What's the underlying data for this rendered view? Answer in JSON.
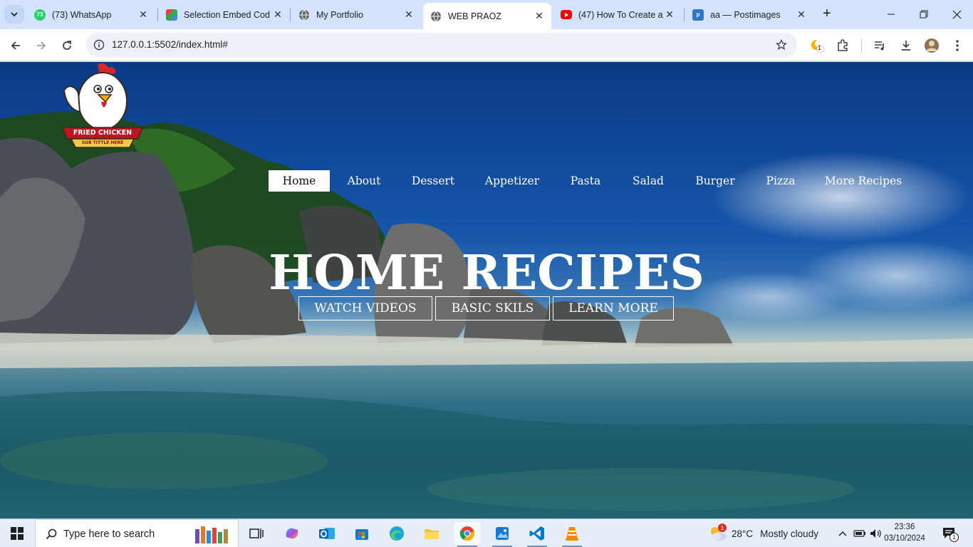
{
  "browser": {
    "tabs": [
      {
        "title": "(73) WhatsApp",
        "favicon": "whatsapp-icon",
        "badge": "73",
        "active": false
      },
      {
        "title": "Selection Embed Cod",
        "favicon": "google-sheets-icon",
        "active": false
      },
      {
        "title": "My Portfolio",
        "favicon": "globe-icon",
        "active": false
      },
      {
        "title": "WEB PRAOZ",
        "favicon": "globe-icon",
        "active": true
      },
      {
        "title": "(47) How To Create a",
        "favicon": "youtube-icon",
        "active": false
      },
      {
        "title": "aa — Postimages",
        "favicon": "postimages-icon",
        "active": false
      }
    ],
    "url": "127.0.0.1:5502/index.html#",
    "extension_badge": "1"
  },
  "page": {
    "logo_title": "FRIED CHICKEN",
    "logo_subtitle": "SUB TITTLE HERE",
    "nav": [
      {
        "label": "Home",
        "active": true
      },
      {
        "label": "About",
        "active": false
      },
      {
        "label": "Dessert",
        "active": false
      },
      {
        "label": "Appetizer",
        "active": false
      },
      {
        "label": "Pasta",
        "active": false
      },
      {
        "label": "Salad",
        "active": false
      },
      {
        "label": "Burger",
        "active": false
      },
      {
        "label": "Pizza",
        "active": false
      },
      {
        "label": "More Recipes",
        "active": false
      }
    ],
    "hero_title": "HOME RECIPES",
    "buttons": [
      "WATCH VIDEOS",
      "BASIC SKILS",
      "LEARN MORE"
    ]
  },
  "taskbar": {
    "search_placeholder": "Type here to search",
    "weather_temp": "28°C",
    "weather_desc": "Mostly cloudy",
    "weather_badge": "1",
    "time": "23:36",
    "date": "03/10/2024",
    "notification_count": "1"
  },
  "colors": {
    "tabstrip": "#d3e3fd",
    "sky": "#0a3a86",
    "taskbar": "#e6eef8"
  }
}
